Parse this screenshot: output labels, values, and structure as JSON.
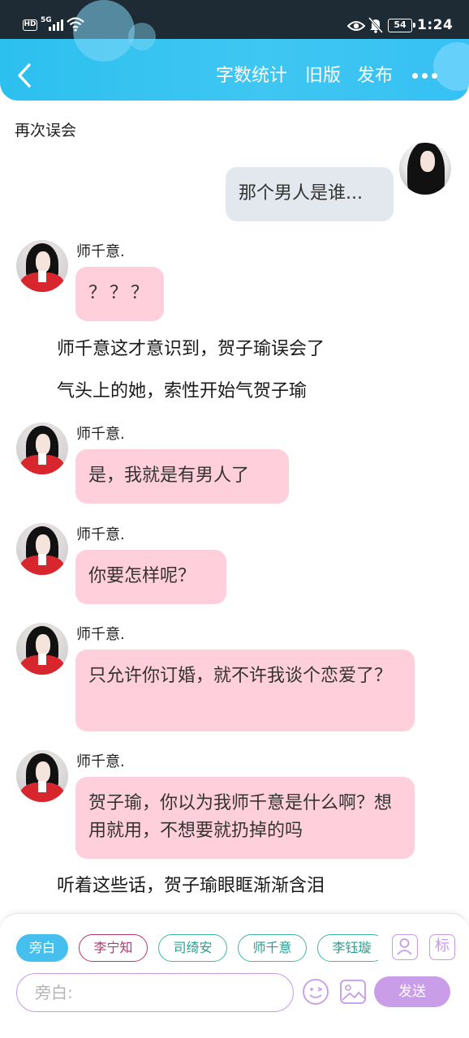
{
  "status_bar": {
    "hd_badge": "HD",
    "network": "5G",
    "battery": "54",
    "time": "1:24"
  },
  "nav": {
    "word_count": "字数统计",
    "old_version": "旧版",
    "publish": "发布"
  },
  "chapter_title": "再次误会",
  "messages": [
    {
      "type": "right",
      "text": "那个男人是谁..."
    },
    {
      "type": "left",
      "speaker": "师千意.",
      "text": "？？？"
    },
    {
      "type": "narration",
      "text": "师千意这才意识到，贺子瑜误会了"
    },
    {
      "type": "narration",
      "text": "气头上的她，索性开始气贺子瑜"
    },
    {
      "type": "left",
      "speaker": "师千意.",
      "text": "是，我就是有男人了"
    },
    {
      "type": "left",
      "speaker": "师千意.",
      "text": "你要怎样呢？"
    },
    {
      "type": "left",
      "speaker": "师千意.",
      "text": "只允许你订婚，就不许我谈个恋爱了？"
    },
    {
      "type": "left",
      "speaker": "师千意.",
      "text": "贺子瑜，你以为我师千意是什么啊？想用就用，不想要就扔掉的吗"
    },
    {
      "type": "narration",
      "text": "听着这些话，贺子瑜眼眶渐渐含泪"
    }
  ],
  "composer": {
    "chips": [
      "旁白",
      "李宁知",
      "司绮安",
      "师千意",
      "李钰璇"
    ],
    "tag_button": "标",
    "input_placeholder": "旁白:",
    "send_label": "发送"
  },
  "colors": {
    "header": "#3ec4f1",
    "bubble_left": "#ffd0dc",
    "bubble_right": "#e3e8ef",
    "accent_purple": "#c99de8",
    "chip_teal": "#3db6a5",
    "chip_active": "#45c0ee"
  }
}
